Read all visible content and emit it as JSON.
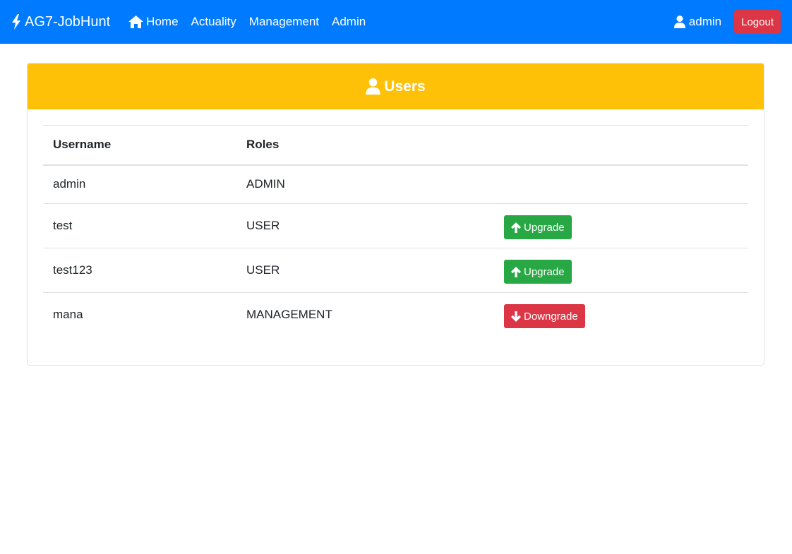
{
  "navbar": {
    "brand": "AG7-JobHunt",
    "links": [
      "Home",
      "Actuality",
      "Management",
      "Admin"
    ],
    "user": "admin",
    "logout": "Logout",
    "color": "#007bff"
  },
  "card": {
    "title": "Users",
    "header_color": "#ffc107",
    "columns": [
      "Username",
      "Roles"
    ],
    "rows": [
      {
        "username": "admin",
        "role": "ADMIN",
        "action": null
      },
      {
        "username": "test",
        "role": "USER",
        "action": "Upgrade"
      },
      {
        "username": "test123",
        "role": "USER",
        "action": "Upgrade"
      },
      {
        "username": "mana",
        "role": "MANAGEMENT",
        "action": "Downgrade"
      }
    ]
  },
  "icons": {
    "brand": "bolt-icon",
    "home": "home-icon",
    "user": "user-icon",
    "upgrade": "arrow-up-icon",
    "downgrade": "arrow-down-icon"
  },
  "colors": {
    "upgrade": "#28a745",
    "downgrade": "#dc3545"
  }
}
